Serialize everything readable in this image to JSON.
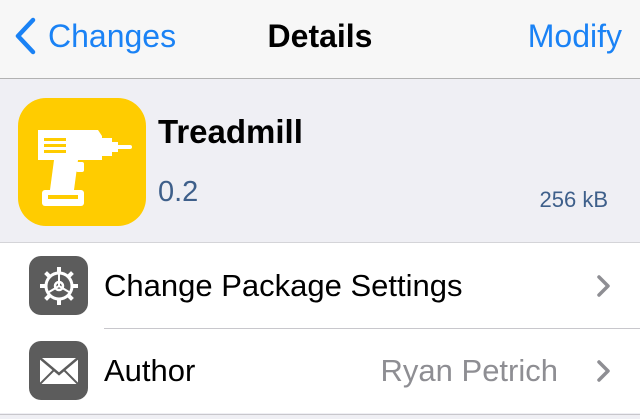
{
  "navbar": {
    "back_label": "Changes",
    "title": "Details",
    "right_label": "Modify"
  },
  "package": {
    "name": "Treadmill",
    "version": "0.2",
    "size": "256 kB",
    "icon": "drill-icon"
  },
  "rows": [
    {
      "label": "Change Package Settings",
      "value": "",
      "icon": "gear-icon"
    },
    {
      "label": "Author",
      "value": "Ryan Petrich",
      "icon": "envelope-icon"
    }
  ],
  "colors": {
    "accent": "#1a82f5",
    "icon_bg": "#ffcc00",
    "meta_text": "#3e5f8a"
  }
}
